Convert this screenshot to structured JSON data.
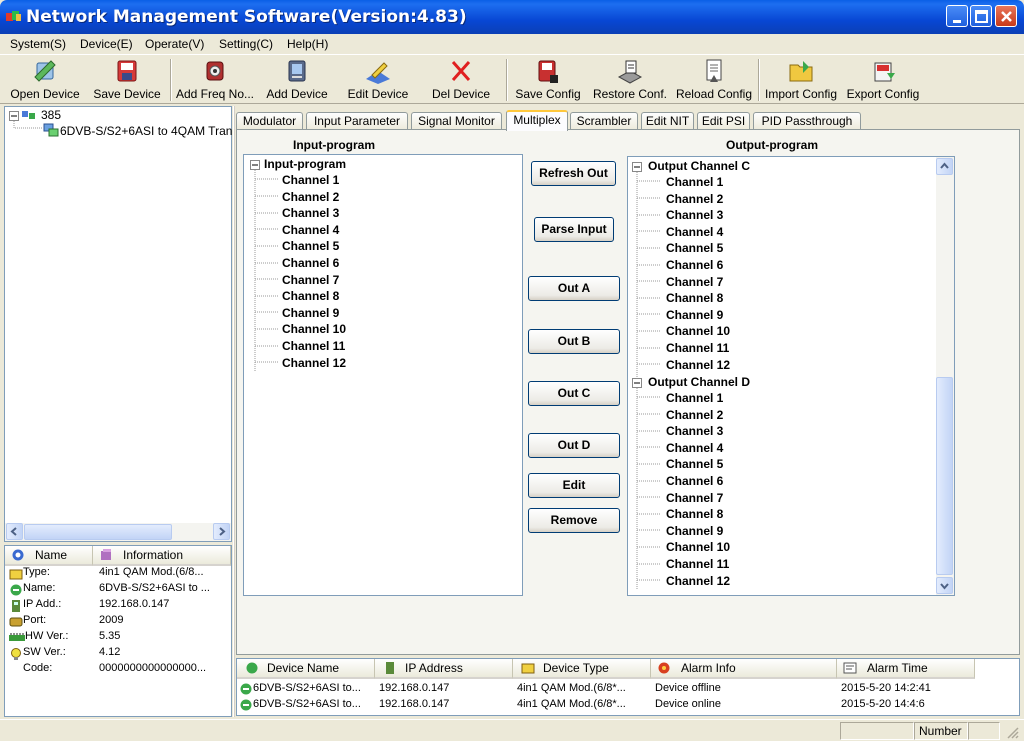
{
  "window": {
    "title": "Network Management Software(Version:4.83)"
  },
  "menu": [
    "System(S)",
    "Device(E)",
    "Operate(V)",
    "Setting(C)",
    "Help(H)"
  ],
  "toolbar": {
    "open_device": "Open Device",
    "save_device": "Save Device",
    "add_freq_node": "Add Freq No...",
    "add_device": "Add Device",
    "edit_device": "Edit Device",
    "del_device": "Del Device",
    "save_config": "Save Config",
    "restore_conf": "Restore Conf.",
    "reload_config": "Reload Config",
    "import_config": "Import Config",
    "export_config": "Export Config"
  },
  "device_tree": {
    "root": "385",
    "device": "6DVB-S/S2+6ASI to 4QAM Tran:"
  },
  "info_panel": {
    "headers": [
      "Name",
      "Information"
    ],
    "rows": [
      {
        "name": "Type:",
        "value": "4in1 QAM Mod.(6/8...",
        "icon": "type-icon"
      },
      {
        "name": "Name:",
        "value": "6DVB-S/S2+6ASI to ...",
        "icon": "name-icon"
      },
      {
        "name": "IP Add.:",
        "value": "192.168.0.147",
        "icon": "ip-icon"
      },
      {
        "name": "Port:",
        "value": "2009",
        "icon": "port-icon"
      },
      {
        "name": "HW Ver.:",
        "value": "5.35",
        "icon": "hw-icon"
      },
      {
        "name": "SW Ver.:",
        "value": "4.12",
        "icon": "sw-icon"
      },
      {
        "name": "Code:",
        "value": "0000000000000000...",
        "icon": ""
      }
    ]
  },
  "tabs": [
    "Modulator",
    "Input Parameter",
    "Signal Monitor",
    "Multiplex",
    "Scrambler",
    "Edit NIT",
    "Edit PSI",
    "PID Passthrough"
  ],
  "active_tab": "Multiplex",
  "input_program": {
    "label": "Input-program",
    "root": "Input-program",
    "channels": [
      "Channel 1",
      "Channel 2",
      "Channel 3",
      "Channel 4",
      "Channel 5",
      "Channel 6",
      "Channel 7",
      "Channel 8",
      "Channel 9",
      "Channel 10",
      "Channel 11",
      "Channel 12"
    ]
  },
  "output_program": {
    "label": "Output-program",
    "groups": [
      {
        "name": "Output Channel C",
        "channels": [
          "Channel 1",
          "Channel 2",
          "Channel 3",
          "Channel 4",
          "Channel 5",
          "Channel 6",
          "Channel 7",
          "Channel 8",
          "Channel 9",
          "Channel 10",
          "Channel 11",
          "Channel 12"
        ]
      },
      {
        "name": "Output Channel D",
        "channels": [
          "Channel 1",
          "Channel 2",
          "Channel 3",
          "Channel 4",
          "Channel 5",
          "Channel 6",
          "Channel 7",
          "Channel 8",
          "Channel 9",
          "Channel 10",
          "Channel 11",
          "Channel 12"
        ]
      }
    ]
  },
  "buttons": {
    "refresh_out": "Refresh Out",
    "parse_input": "Parse Input",
    "out_a": "Out A",
    "out_b": "Out B",
    "out_c": "Out C",
    "out_d": "Out D",
    "edit": "Edit",
    "remove": "Remove"
  },
  "alarm_table": {
    "headers": [
      "Device Name",
      "IP Address",
      "Device Type",
      "Alarm Info",
      "Alarm Time"
    ],
    "rows": [
      [
        "6DVB-S/S2+6ASI to...",
        "192.168.0.147",
        "4in1 QAM Mod.(6/8*...",
        "Device offline",
        "2015-5-20 14:2:41"
      ],
      [
        "6DVB-S/S2+6ASI to...",
        "192.168.0.147",
        "4in1 QAM Mod.(6/8*...",
        "Device online",
        "2015-5-20 14:4:6"
      ]
    ]
  },
  "status": {
    "number": "Number"
  },
  "colors": {
    "title_bar": "#0847d4",
    "tab_highlight": "#ffc83c",
    "close_button": "#c8391a"
  }
}
